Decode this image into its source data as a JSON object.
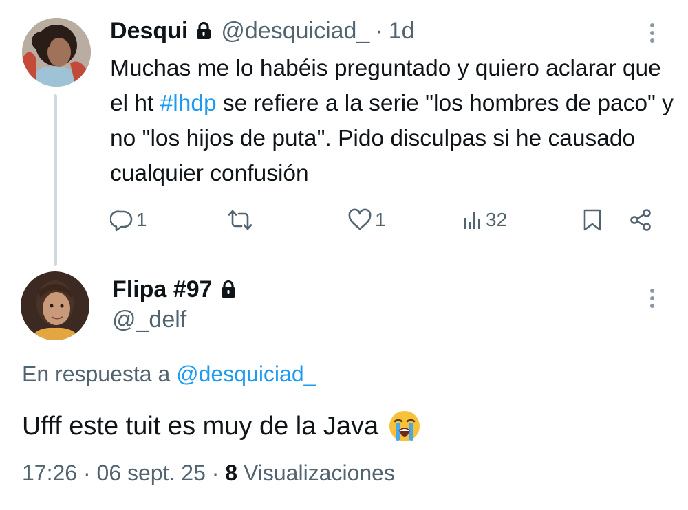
{
  "parent_tweet": {
    "display_name": "Desqui",
    "handle": "@desquiciad_",
    "separator": "·",
    "time": "1d",
    "text_before_hashtag": "Muchas me lo habéis preguntado y quiero aclarar que el ht ",
    "hashtag": "#lhdp",
    "text_after_hashtag": " se refiere a la serie \"los hombres de paco\" y no \"los hijos de puta\". Pido disculpas si he causado cualquier confusión",
    "actions": {
      "replies": "1",
      "retweets": "",
      "likes": "1",
      "views": "32"
    }
  },
  "reply_tweet": {
    "display_name": "Flipa #97",
    "handle": "@_delf",
    "in_reply_prefix": "En respuesta a ",
    "in_reply_mention": "@desquiciad_",
    "text": "Ufff este tuit es muy de la Java",
    "emoji": "loudly-crying-face",
    "time": "17:26",
    "date": "06 sept. 25",
    "separator": "·",
    "views_count": "8",
    "views_label": "Visualizaciones"
  },
  "icons": {
    "lock": "lock-icon",
    "more": "more-vertical-icon",
    "reply": "reply-icon",
    "retweet": "retweet-icon",
    "like": "heart-icon",
    "views": "views-icon",
    "bookmark": "bookmark-icon",
    "share": "share-icon"
  },
  "colors": {
    "text": "#0f1419",
    "muted": "#536471",
    "link": "#1d9bf0",
    "thread_line": "#cfd9de"
  }
}
